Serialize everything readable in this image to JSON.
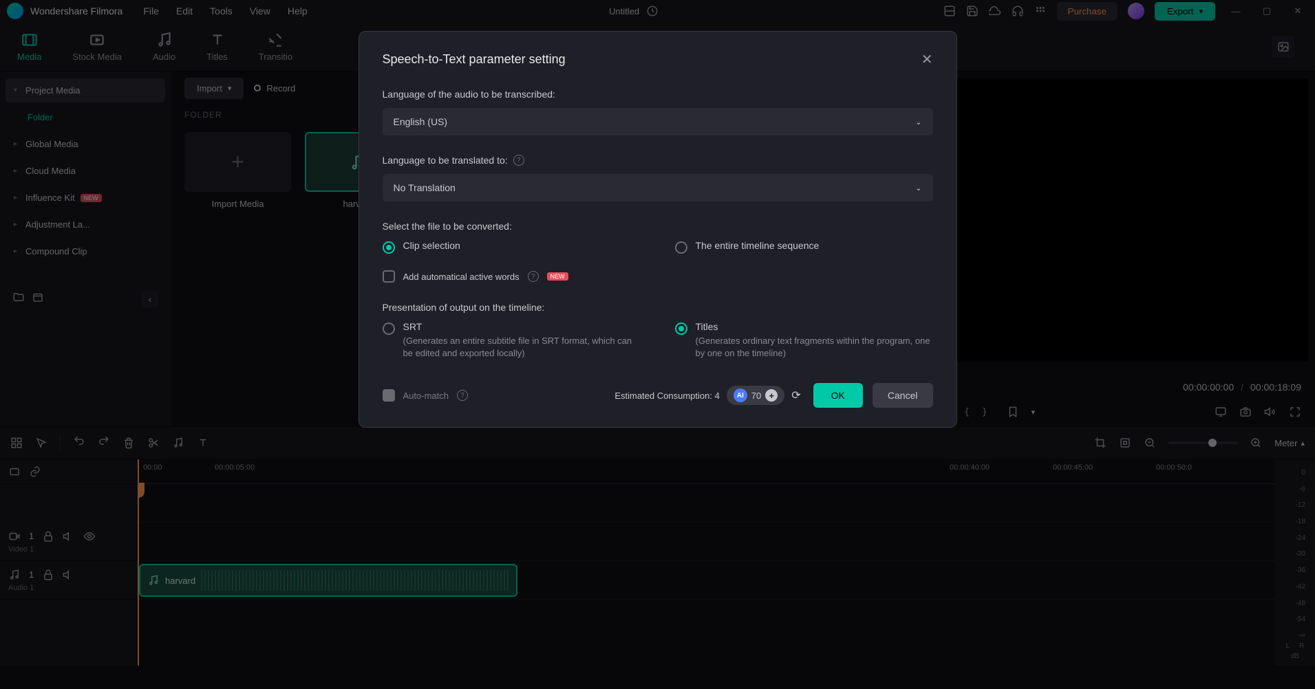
{
  "app_name": "Wondershare Filmora",
  "menus": [
    "File",
    "Edit",
    "Tools",
    "View",
    "Help"
  ],
  "project_title": "Untitled",
  "header_buttons": {
    "purchase": "Purchase",
    "export": "Export"
  },
  "top_tabs": [
    {
      "label": "Media"
    },
    {
      "label": "Stock Media"
    },
    {
      "label": "Audio"
    },
    {
      "label": "Titles"
    },
    {
      "label": "Transitio"
    }
  ],
  "sidebar": {
    "project_media": "Project Media",
    "folder": "Folder",
    "global_media": "Global Media",
    "cloud_media": "Cloud Media",
    "influence_kit": "Influence Kit",
    "adjustment_la": "Adjustment La...",
    "compound_clip": "Compound Clip",
    "new_badge": "NEW"
  },
  "browser": {
    "import": "Import",
    "record": "Record",
    "folder_label": "FOLDER",
    "tiles": {
      "import_media": "Import Media",
      "harvard": "harvard"
    }
  },
  "preview": {
    "current": "00:00:00:00",
    "total": "00:00:18:09"
  },
  "toolbar_right": {
    "meter": "Meter"
  },
  "timeline": {
    "ruler": [
      "00:00",
      "00:00:05:00",
      "00:00:40:00",
      "00:00:45:00",
      "00:00:50:0"
    ],
    "tracks": {
      "video_num": "1",
      "video_label": "Video 1",
      "audio_num": "1",
      "audio_label": "Audio 1"
    },
    "clip_name": "harvard"
  },
  "meter_scale": [
    "0",
    "-6",
    "-12",
    "-18",
    "-24",
    "-30",
    "-36",
    "-42",
    "-48",
    "-54",
    "-∞"
  ],
  "meter_lr": {
    "l": "L",
    "r": "R",
    "db": "dB"
  },
  "modal": {
    "title": "Speech-to-Text parameter setting",
    "lang_audio_label": "Language of the audio to be transcribed:",
    "lang_audio_value": "English (US)",
    "lang_trans_label": "Language to be translated to:",
    "lang_trans_value": "No Translation",
    "select_file_label": "Select the file to be converted:",
    "clip_selection": "Clip selection",
    "entire_timeline": "The entire timeline sequence",
    "active_words": "Add automatical active words",
    "new_badge": "NEW",
    "presentation_label": "Presentation of output on the timeline:",
    "srt_label": "SRT",
    "srt_desc": "(Generates an entire subtitle file in SRT format, which can be edited and exported locally)",
    "titles_label": "Titles",
    "titles_desc": "(Generates ordinary text fragments within the program, one by one on the timeline)",
    "estimated": "Estimated Consumption: 4",
    "ai_credits": "70",
    "auto_match": "Auto-match",
    "ok": "OK",
    "cancel": "Cancel"
  }
}
